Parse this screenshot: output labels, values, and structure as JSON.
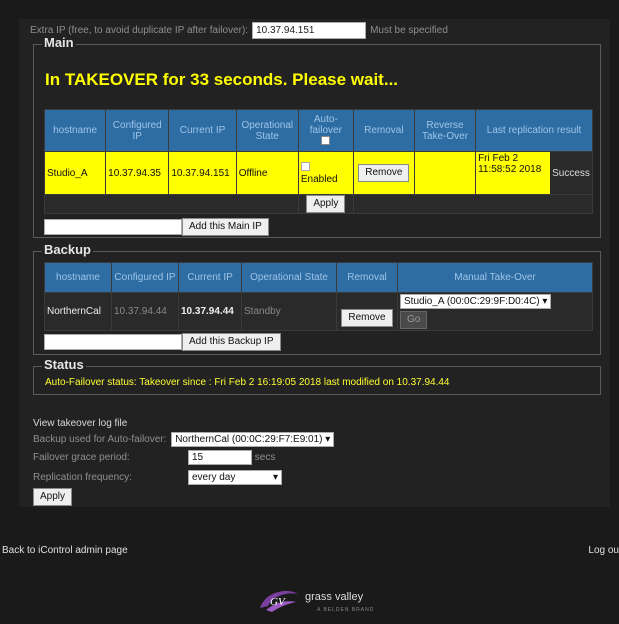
{
  "top": {
    "label": "Extra IP (free, to avoid duplicate IP after failover):",
    "ip_value": "10.37.94.151",
    "note": "Must be specified"
  },
  "main": {
    "legend": "Main",
    "takeover_message": "In TAKEOVER for 33 seconds. Please wait...",
    "headers": [
      "hostname",
      "Configured IP",
      "Current IP",
      "Operational State",
      "Auto-failover",
      "Removal",
      "Reverse Take-Over",
      "Last replication result"
    ],
    "row": {
      "hostname": "Studio_A",
      "configured_ip": "10.37.94.35",
      "current_ip": "10.37.94.151",
      "state": "Offline",
      "auto_failover_label": "Enabled",
      "remove_label": "Remove",
      "replication_time": "Fri Feb 2 11:58:52 2018",
      "replication_status": "Success"
    },
    "apply_label": "Apply",
    "add_label": "Add this Main IP"
  },
  "backup": {
    "legend": "Backup",
    "headers": [
      "hostname",
      "Configured IP",
      "Current IP",
      "Operational State",
      "Removal",
      "Manual Take-Over"
    ],
    "row": {
      "hostname": "NorthernCal",
      "configured_ip": "10.37.94.44",
      "current_ip": "10.37.94.44",
      "state": "Standby",
      "remove_label": "Remove",
      "takeover_select": "Studio_A (00:0C:29:9F:D0:4C)",
      "go_label": "Go"
    },
    "add_label": "Add this Backup IP"
  },
  "status": {
    "legend": "Status",
    "text": "Auto-Failover status: Takeover since : Fri Feb 2 16:19:05 2018 last modified on 10.37.94.44"
  },
  "settings": {
    "view_log": "View takeover log file",
    "backup_label": "Backup used for Auto-failover:",
    "backup_value": "NorthernCal (00:0C:29:F7:E9:01)",
    "grace_label": "Failover grace period:",
    "grace_value": "15",
    "grace_unit": "secs",
    "freq_label": "Replication frequency:",
    "freq_value": "every day",
    "apply_label": "Apply"
  },
  "footer": {
    "back": "Back to iControl admin page",
    "logout": "Log ou"
  },
  "brand": {
    "name": "grass valley",
    "sub": "A BELDEN BRAND"
  },
  "colors": {
    "header_blue": "#2e6da4",
    "highlight_yellow": "#ffff00",
    "panel": "#222222"
  }
}
